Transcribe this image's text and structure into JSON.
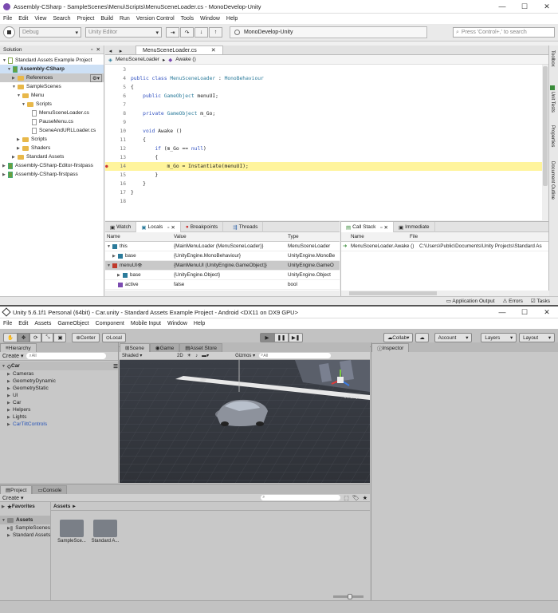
{
  "md": {
    "title": "Assembly-CSharp - SampleScenes\\Menu\\Scripts\\MenuSceneLoader.cs - MonoDevelop-Unity",
    "menu": [
      "File",
      "Edit",
      "View",
      "Search",
      "Project",
      "Build",
      "Run",
      "Version Control",
      "Tools",
      "Window",
      "Help"
    ],
    "toolbar": {
      "config": "Debug",
      "target": "Unity Editor",
      "status": "MonoDevelop-Unity",
      "search_placeholder": "Press 'Control+,' to search"
    },
    "solution": {
      "title": "Solution",
      "items": [
        "Standard Assets Example Project",
        "Assembly-CSharp",
        "References",
        "SampleScenes",
        "Menu",
        "Scripts",
        "MenuSceneLoader.cs",
        "PauseMenu.cs",
        "SceneAndURLLoader.cs",
        "Scripts",
        "Shaders",
        "Standard Assets",
        "Assembly-CSharp-Editor-firstpass",
        "Assembly-CSharp-firstpass"
      ]
    },
    "editor": {
      "tab": "MenuSceneLoader.cs",
      "breadcrumb": [
        "MenuSceneLoader",
        "Awake ()"
      ],
      "lines": [
        {
          "n": "3",
          "t": ""
        },
        {
          "n": "4",
          "t": "public class MenuSceneLoader : MonoBehaviour"
        },
        {
          "n": "5",
          "t": "{"
        },
        {
          "n": "6",
          "t": "    public GameObject menuUI;"
        },
        {
          "n": "7",
          "t": ""
        },
        {
          "n": "8",
          "t": "    private GameObject m_Go;"
        },
        {
          "n": "9",
          "t": ""
        },
        {
          "n": "10",
          "t": "    void Awake ()"
        },
        {
          "n": "11",
          "t": "    {"
        },
        {
          "n": "12",
          "t": "        if (m_Go == null)"
        },
        {
          "n": "13",
          "t": "        {"
        },
        {
          "n": "14",
          "t": "            m_Go = Instantiate(menuUI);"
        },
        {
          "n": "15",
          "t": "        }"
        },
        {
          "n": "16",
          "t": "    }"
        },
        {
          "n": "17",
          "t": "}"
        },
        {
          "n": "18",
          "t": ""
        }
      ]
    },
    "side_tabs": [
      "Toolbox",
      "Unit Tests",
      "Properties",
      "Document Outline"
    ],
    "pads": {
      "tabs": [
        "Watch",
        "Locals",
        "Breakpoints",
        "Threads"
      ],
      "headers": [
        "Name",
        "Value",
        "Type"
      ],
      "rows": [
        {
          "name": "this",
          "value": "{MainMenuLoader (MenuSceneLoader)}",
          "type": "MenuSceneLoader"
        },
        {
          "name": "base",
          "value": "{UnityEngine.MonoBehaviour}",
          "type": "UnityEngine.MonoBe"
        },
        {
          "name": "menuUI",
          "value": "{MainMenuUI (UnityEngine.GameObject)}",
          "type": "UnityEngine.GameO"
        },
        {
          "name": "base",
          "value": "{UnityEngine.Object}",
          "type": "UnityEngine.Object"
        },
        {
          "name": "active",
          "value": "false",
          "type": "bool"
        }
      ],
      "right_tabs": [
        "Call Stack",
        "Immediate"
      ],
      "right_headers": [
        "Name",
        "File"
      ],
      "right_rows": [
        {
          "name": "MenuSceneLoader.Awake ()",
          "file": "C:\\Users\\Public\\Documents\\Unity Projects\\Standard As"
        }
      ]
    },
    "statusbar": [
      "Application Output",
      "Errors",
      "Tasks"
    ]
  },
  "unity": {
    "title": "Unity 5.6.1f1 Personal (64bit) - Car.unity - Standard Assets Example Project - Android <DX11 on DX9 GPU>",
    "menu": [
      "File",
      "Edit",
      "Assets",
      "GameObject",
      "Component",
      "Mobile Input",
      "Window",
      "Help"
    ],
    "toolbar": {
      "center": "Center",
      "local": "Local",
      "collab": "Collab",
      "account": "Account",
      "layers": "Layers",
      "layout": "Layout"
    },
    "hierarchy": {
      "title": "Hierarchy",
      "create": "Create",
      "search": "All",
      "root": "Car",
      "items": [
        "Cameras",
        "GeometryDynamic",
        "GeometryStatic",
        "UI",
        "Car",
        "Helpers",
        "Lights",
        "CarTiltControls"
      ]
    },
    "scene": {
      "tabs": [
        "Scene",
        "Game",
        "Asset Store"
      ],
      "shaded": "Shaded",
      "mode2d": "2D",
      "gizmos": "Gizmos",
      "search": "All",
      "persp": "< Persp"
    },
    "inspector": {
      "title": "Inspector"
    },
    "project": {
      "tabs": [
        "Project",
        "Console"
      ],
      "create": "Create",
      "favorites": "Favorites",
      "assets_label": "Assets",
      "tree": [
        "Assets",
        "SampleScenes",
        "Standard Assets"
      ],
      "folders": [
        "SampleSce...",
        "Standard A..."
      ]
    }
  }
}
